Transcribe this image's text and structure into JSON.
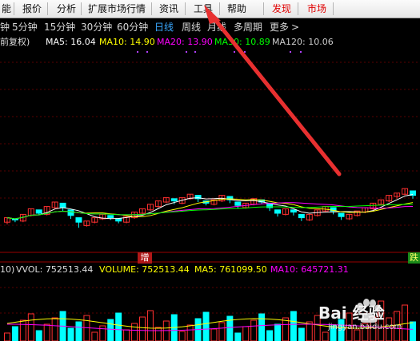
{
  "menu": {
    "items": [
      "能",
      "报价",
      "分析",
      "扩展市场行情",
      "资讯",
      "工具",
      "帮助"
    ],
    "discover": "发现",
    "market": "市场"
  },
  "periods": [
    "钟",
    "5分钟",
    "15分钟",
    "30分钟",
    "60分钟",
    "日线",
    "周线",
    "月线",
    "多周期",
    "更多"
  ],
  "active_period": "日线",
  "more_arrow": ">",
  "ma": {
    "fq": "前复权)",
    "ma5": "MA5: 16.04",
    "ma10": "MA10: 14.90",
    "ma20": "MA20: 13.90",
    "ma30": "MA30: 10.89",
    "ma120": "MA120: 10.06"
  },
  "volume_bar": {
    "prefix": "10)",
    "vvol": "VVOL: 752513.44",
    "volume": "VOLUME: 752513.44",
    "ma5": "MA5: 761099.50",
    "ma10": "MA10: 645721.31"
  },
  "tags": {
    "zeng": "增",
    "right": "跌"
  },
  "watermark": {
    "brand": "Bai 经验",
    "url": "jingyan.baidu.com"
  },
  "colors": {
    "ma5": "#ffffff",
    "ma10": "#ffff00",
    "ma20": "#ff00ff",
    "ma30": "#00ff00",
    "ma120": "#cccccc",
    "up": "#ff3030",
    "down": "#00ffff",
    "arrow": "#e83030",
    "active": "#39a8ff"
  },
  "chart_data": {
    "type": "candlestick",
    "price_series": {
      "name": "K",
      "ohlc_approx": [
        [
          12.2,
          12.6,
          12.0,
          12.5
        ],
        [
          12.5,
          12.4,
          12.2,
          12.3
        ],
        [
          12.3,
          12.9,
          12.2,
          12.8
        ],
        [
          12.8,
          13.4,
          12.7,
          13.3
        ],
        [
          13.3,
          13.0,
          12.8,
          12.9
        ],
        [
          12.9,
          13.6,
          12.8,
          13.5
        ],
        [
          13.5,
          14.0,
          13.4,
          13.9
        ],
        [
          13.9,
          13.5,
          13.2,
          13.3
        ],
        [
          13.3,
          12.8,
          12.5,
          12.6
        ],
        [
          12.6,
          12.2,
          11.7,
          11.9
        ],
        [
          11.9,
          12.3,
          11.8,
          12.2
        ],
        [
          12.2,
          12.6,
          12.1,
          12.5
        ],
        [
          12.5,
          12.9,
          12.4,
          12.8
        ],
        [
          12.8,
          12.6,
          12.4,
          12.5
        ],
        [
          12.5,
          12.3,
          12.1,
          12.2
        ],
        [
          12.2,
          12.7,
          12.1,
          12.6
        ],
        [
          12.6,
          13.1,
          12.5,
          13.0
        ],
        [
          13.0,
          13.4,
          12.9,
          13.3
        ],
        [
          13.3,
          13.8,
          13.2,
          13.6
        ],
        [
          13.6,
          14.1,
          13.5,
          14.0
        ],
        [
          14.0,
          14.4,
          13.9,
          14.3
        ],
        [
          14.3,
          14.1,
          13.8,
          13.9
        ],
        [
          13.9,
          14.4,
          13.8,
          14.3
        ],
        [
          14.3,
          14.7,
          14.2,
          14.6
        ],
        [
          14.6,
          14.3,
          14.0,
          14.1
        ],
        [
          14.1,
          13.9,
          13.7,
          13.8
        ],
        [
          13.8,
          14.2,
          13.7,
          14.1
        ],
        [
          14.1,
          14.6,
          14.0,
          14.5
        ],
        [
          14.5,
          14.2,
          13.9,
          14.0
        ],
        [
          14.0,
          13.7,
          13.4,
          13.5
        ],
        [
          13.5,
          13.9,
          13.4,
          13.8
        ],
        [
          13.8,
          14.3,
          13.7,
          14.2
        ],
        [
          14.2,
          14.0,
          13.8,
          13.9
        ],
        [
          13.9,
          13.5,
          13.2,
          13.3
        ],
        [
          13.3,
          13.0,
          12.7,
          12.9
        ],
        [
          12.9,
          13.4,
          12.8,
          13.3
        ],
        [
          13.3,
          13.1,
          12.8,
          12.9
        ],
        [
          12.9,
          12.6,
          12.3,
          12.4
        ],
        [
          12.4,
          12.9,
          12.3,
          12.8
        ],
        [
          12.8,
          13.3,
          12.7,
          13.2
        ],
        [
          13.2,
          13.6,
          13.1,
          13.5
        ],
        [
          13.5,
          13.2,
          12.9,
          13.0
        ],
        [
          13.0,
          12.7,
          12.4,
          12.5
        ],
        [
          12.5,
          12.9,
          12.4,
          12.8
        ],
        [
          12.8,
          13.2,
          12.7,
          13.1
        ],
        [
          13.1,
          13.5,
          13.0,
          13.4
        ],
        [
          13.4,
          13.9,
          13.3,
          13.8
        ],
        [
          13.8,
          14.2,
          13.7,
          14.1
        ],
        [
          14.1,
          14.6,
          14.0,
          14.5
        ],
        [
          14.5,
          14.8,
          14.3,
          14.7
        ],
        [
          14.7,
          15.2,
          14.6,
          15.0
        ],
        [
          15.0,
          14.6,
          14.3,
          14.4
        ]
      ]
    }
  }
}
